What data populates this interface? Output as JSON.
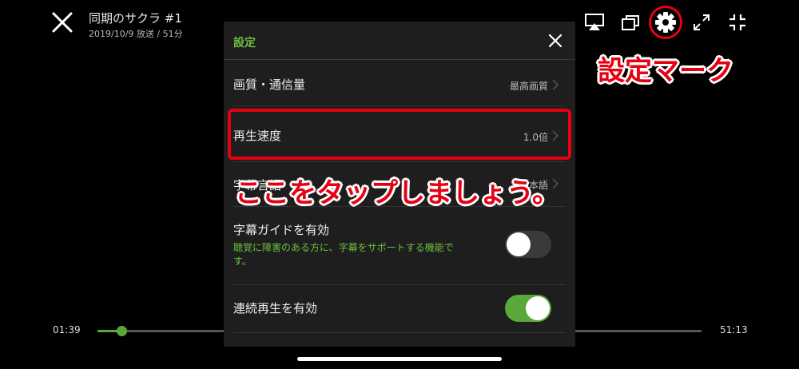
{
  "player": {
    "title": "同期のサクラ #1",
    "subtitle": "2019/10/9 放送 / 51分",
    "current_time": "01:39",
    "duration": "51:13",
    "progress": 0.04,
    "accent_color": "#5aa83a"
  },
  "top_icons": [
    "airplay-icon",
    "windows-icon",
    "gear-icon",
    "expand-icon",
    "minimize-icon"
  ],
  "settings": {
    "header_title": "設定",
    "rows": [
      {
        "label": "画質・通信量",
        "value": "最高画質"
      },
      {
        "label": "再生速度",
        "value": "1.0倍"
      },
      {
        "label": "字幕言語",
        "value": "日本語"
      }
    ],
    "subtitle_guide": {
      "label": "字幕ガイドを有効",
      "description": "聴覚に障害のある方に、字幕をサポートする機能です。",
      "enabled": false
    },
    "continuous_play": {
      "label": "連続再生を有効",
      "enabled": true
    }
  },
  "annotations": {
    "gear_callout": "設定マーク",
    "tap_callout": "ここをタップしましょう。",
    "color": "#e60012"
  }
}
